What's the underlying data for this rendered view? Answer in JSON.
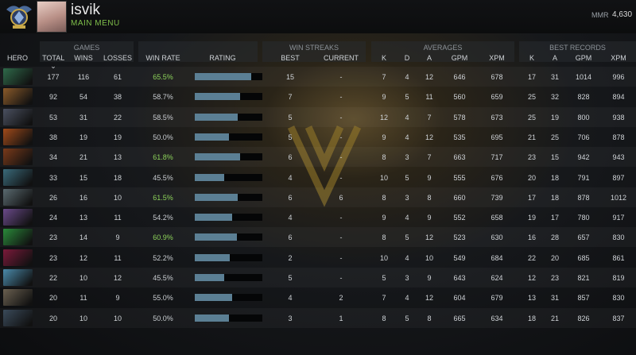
{
  "profile": {
    "username": "isvik",
    "submenu": "MAIN MENU",
    "mmr_label": "MMR",
    "mmr_value": "4,630"
  },
  "groups": {
    "games": "GAMES",
    "win_streaks": "WIN STREAKS",
    "averages": "AVERAGES",
    "best_records": "BEST RECORDS"
  },
  "columns": {
    "hero": "HERO",
    "total": "TOTAL",
    "sort_arrow": "⌄",
    "wins": "WINS",
    "losses": "LOSSES",
    "win_rate": "WIN RATE",
    "rating": "RATING",
    "best": "BEST",
    "current": "CURRENT",
    "avg_k": "K",
    "avg_d": "D",
    "avg_a": "A",
    "avg_gpm": "GPM",
    "avg_xpm": "XPM",
    "best_k": "K",
    "best_a": "A",
    "best_gpm": "GPM",
    "best_xpm": "XPM"
  },
  "colors": {
    "win_rate_good": "#8cd25a",
    "rating_bar": "#5b7f94",
    "main_menu": "#7fbf4a"
  },
  "rows": [
    {
      "hero_icon": "hero-portrait-1",
      "hero_color": "#2f6a4a",
      "total": "177",
      "wins": "116",
      "losses": "61",
      "win_rate": "65.5%",
      "good": true,
      "rating": 0.83,
      "best": "15",
      "current": "-",
      "k": "7",
      "d": "4",
      "a": "12",
      "gpm": "646",
      "xpm": "678",
      "bk": "17",
      "ba": "31",
      "bgpm": "1014",
      "bxpm": "996"
    },
    {
      "hero_icon": "hero-portrait-2",
      "hero_color": "#8a5a2a",
      "total": "92",
      "wins": "54",
      "losses": "38",
      "win_rate": "58.7%",
      "good": false,
      "rating": 0.67,
      "best": "7",
      "current": "-",
      "k": "9",
      "d": "5",
      "a": "11",
      "gpm": "560",
      "xpm": "659",
      "bk": "25",
      "ba": "32",
      "bgpm": "828",
      "bxpm": "894"
    },
    {
      "hero_icon": "hero-portrait-3",
      "hero_color": "#4a5060",
      "total": "53",
      "wins": "31",
      "losses": "22",
      "win_rate": "58.5%",
      "good": false,
      "rating": 0.64,
      "best": "5",
      "current": "-",
      "k": "12",
      "d": "4",
      "a": "7",
      "gpm": "578",
      "xpm": "673",
      "bk": "25",
      "ba": "19",
      "bgpm": "800",
      "bxpm": "938"
    },
    {
      "hero_icon": "hero-portrait-4",
      "hero_color": "#a04a1a",
      "total": "38",
      "wins": "19",
      "losses": "19",
      "win_rate": "50.0%",
      "good": false,
      "rating": 0.5,
      "best": "5",
      "current": "-",
      "k": "9",
      "d": "4",
      "a": "12",
      "gpm": "535",
      "xpm": "695",
      "bk": "21",
      "ba": "25",
      "bgpm": "706",
      "bxpm": "878"
    },
    {
      "hero_icon": "hero-portrait-5",
      "hero_color": "#7a3a1a",
      "total": "34",
      "wins": "21",
      "losses": "13",
      "win_rate": "61.8%",
      "good": true,
      "rating": 0.67,
      "best": "6",
      "current": "-",
      "k": "8",
      "d": "3",
      "a": "7",
      "gpm": "663",
      "xpm": "717",
      "bk": "23",
      "ba": "15",
      "bgpm": "942",
      "bxpm": "943"
    },
    {
      "hero_icon": "hero-portrait-6",
      "hero_color": "#3a6a7a",
      "total": "33",
      "wins": "15",
      "losses": "18",
      "win_rate": "45.5%",
      "good": false,
      "rating": 0.44,
      "best": "4",
      "current": "-",
      "k": "10",
      "d": "5",
      "a": "9",
      "gpm": "555",
      "xpm": "676",
      "bk": "20",
      "ba": "18",
      "bgpm": "791",
      "bxpm": "897"
    },
    {
      "hero_icon": "hero-portrait-7",
      "hero_color": "#5a6a70",
      "total": "26",
      "wins": "16",
      "losses": "10",
      "win_rate": "61.5%",
      "good": true,
      "rating": 0.64,
      "best": "6",
      "current": "6",
      "k": "8",
      "d": "3",
      "a": "8",
      "gpm": "660",
      "xpm": "739",
      "bk": "17",
      "ba": "18",
      "bgpm": "878",
      "bxpm": "1012"
    },
    {
      "hero_icon": "hero-portrait-8",
      "hero_color": "#6a4a8a",
      "total": "24",
      "wins": "13",
      "losses": "11",
      "win_rate": "54.2%",
      "good": false,
      "rating": 0.55,
      "best": "4",
      "current": "-",
      "k": "9",
      "d": "4",
      "a": "9",
      "gpm": "552",
      "xpm": "658",
      "bk": "19",
      "ba": "17",
      "bgpm": "780",
      "bxpm": "917"
    },
    {
      "hero_icon": "hero-portrait-9",
      "hero_color": "#2a8a3a",
      "total": "23",
      "wins": "14",
      "losses": "9",
      "win_rate": "60.9%",
      "good": true,
      "rating": 0.62,
      "best": "6",
      "current": "-",
      "k": "8",
      "d": "5",
      "a": "12",
      "gpm": "523",
      "xpm": "630",
      "bk": "16",
      "ba": "28",
      "bgpm": "657",
      "bxpm": "830"
    },
    {
      "hero_icon": "hero-portrait-10",
      "hero_color": "#7a1a3a",
      "total": "23",
      "wins": "12",
      "losses": "11",
      "win_rate": "52.2%",
      "good": false,
      "rating": 0.52,
      "best": "2",
      "current": "-",
      "k": "10",
      "d": "4",
      "a": "10",
      "gpm": "549",
      "xpm": "684",
      "bk": "22",
      "ba": "20",
      "bgpm": "685",
      "bxpm": "861"
    },
    {
      "hero_icon": "hero-portrait-11",
      "hero_color": "#4a8aaa",
      "total": "22",
      "wins": "10",
      "losses": "12",
      "win_rate": "45.5%",
      "good": false,
      "rating": 0.44,
      "best": "5",
      "current": "-",
      "k": "5",
      "d": "3",
      "a": "9",
      "gpm": "643",
      "xpm": "624",
      "bk": "12",
      "ba": "23",
      "bgpm": "821",
      "bxpm": "819"
    },
    {
      "hero_icon": "hero-portrait-12",
      "hero_color": "#6a6050",
      "total": "20",
      "wins": "11",
      "losses": "9",
      "win_rate": "55.0%",
      "good": false,
      "rating": 0.55,
      "best": "4",
      "current": "2",
      "k": "7",
      "d": "4",
      "a": "12",
      "gpm": "604",
      "xpm": "679",
      "bk": "13",
      "ba": "31",
      "bgpm": "857",
      "bxpm": "830"
    },
    {
      "hero_icon": "hero-portrait-13",
      "hero_color": "#3a4a5a",
      "total": "20",
      "wins": "10",
      "losses": "10",
      "win_rate": "50.0%",
      "good": false,
      "rating": 0.5,
      "best": "3",
      "current": "1",
      "k": "8",
      "d": "5",
      "a": "8",
      "gpm": "665",
      "xpm": "634",
      "bk": "18",
      "ba": "21",
      "bgpm": "826",
      "bxpm": "837"
    }
  ]
}
